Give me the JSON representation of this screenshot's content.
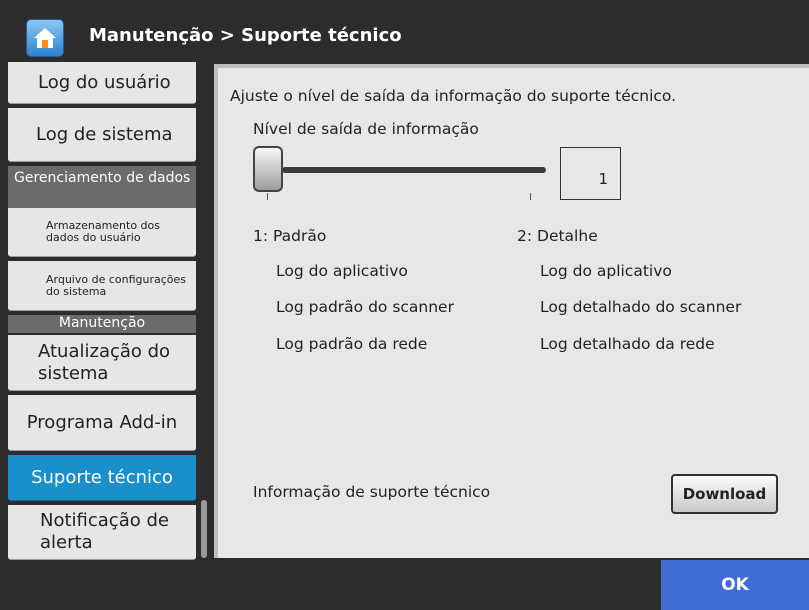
{
  "header": {
    "title": "Manutenção > Suporte técnico",
    "home_icon": "home-icon"
  },
  "sidebar": {
    "log_usuario": "Log do usuário",
    "log_sistema": "Log de sistema",
    "cat_gerenciamento": "Gerenciamento de dados",
    "armazenamento": "Armazenamento dos dados do usuário",
    "arquivo_config": "Arquivo de configurações do sistema",
    "cat_manutencao": "Manutenção",
    "atualizacao": "Atualização do sistema",
    "addin": "Programa Add-in",
    "suporte": "Suporte técnico",
    "notificacao": "Notificação de alerta"
  },
  "main": {
    "instruction": "Ajuste o nível de saída da informação do suporte técnico.",
    "level_label": "Nível de saída de informação",
    "level_value": "1",
    "level_min": 1,
    "level_max": 2,
    "col1": {
      "heading": "1: Padrão",
      "items": [
        "Log do aplicativo",
        "Log padrão do scanner",
        "Log padrão da rede"
      ]
    },
    "col2": {
      "heading": "2: Detalhe",
      "items": [
        "Log do aplicativo",
        "Log detalhado do scanner",
        "Log detalhado da rede"
      ]
    },
    "support_info_label": "Informação de suporte técnico",
    "download_label": "Download"
  },
  "footer": {
    "ok_label": "OK"
  },
  "colors": {
    "accent_active": "#1a8fc9",
    "ok_button": "#3f6bd4",
    "header_bg": "#2c2c2c"
  }
}
